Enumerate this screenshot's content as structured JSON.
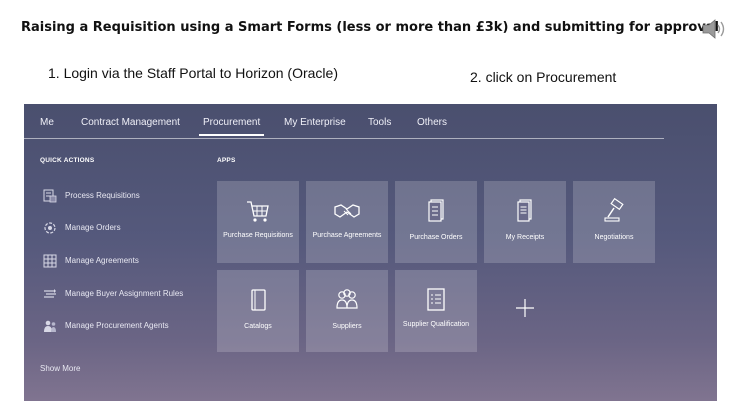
{
  "slide": {
    "title": "Raising a Requisition using a Smart Forms (less or more than £3k) and submitting for approval",
    "step1": "1. Login via the Staff Portal to Horizon (Oracle)",
    "step2": "2. click on Procurement",
    "audio_icon": "speaker-icon"
  },
  "nav": {
    "items": [
      {
        "label": "Me",
        "active": false
      },
      {
        "label": "Contract Management",
        "active": false
      },
      {
        "label": "Procurement",
        "active": true
      },
      {
        "label": "My Enterprise",
        "active": false
      },
      {
        "label": "Tools",
        "active": false
      },
      {
        "label": "Others",
        "active": false
      }
    ]
  },
  "quick_actions": {
    "heading": "QUICK ACTIONS",
    "items": [
      {
        "label": "Process Requisitions",
        "icon": "process-requisitions-icon"
      },
      {
        "label": "Manage Orders",
        "icon": "manage-orders-icon"
      },
      {
        "label": "Manage Agreements",
        "icon": "manage-agreements-icon"
      },
      {
        "label": "Manage Buyer Assignment Rules",
        "icon": "buyer-assignment-rules-icon"
      },
      {
        "label": "Manage Procurement Agents",
        "icon": "procurement-agents-icon"
      }
    ],
    "show_more": "Show More"
  },
  "apps": {
    "heading": "APPS",
    "tiles": [
      {
        "label": "Purchase Requisitions",
        "icon": "shopping-cart-icon"
      },
      {
        "label": "Purchase Agreements",
        "icon": "handshake-icon"
      },
      {
        "label": "Purchase Orders",
        "icon": "document-stack-icon"
      },
      {
        "label": "My Receipts",
        "icon": "receipt-icon"
      },
      {
        "label": "Negotiations",
        "icon": "gavel-icon"
      },
      {
        "label": "Catalogs",
        "icon": "book-icon"
      },
      {
        "label": "Suppliers",
        "icon": "people-icon"
      },
      {
        "label": "Supplier Qualification",
        "icon": "checklist-icon"
      }
    ],
    "add_icon": "plus-icon"
  }
}
